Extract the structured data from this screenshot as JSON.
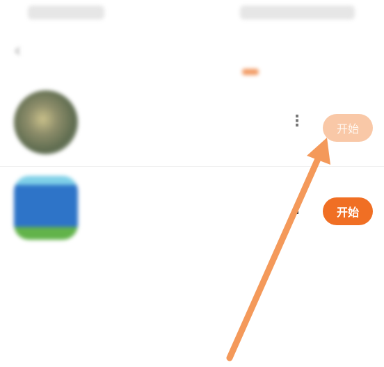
{
  "header": {
    "back_icon": "back-arrow-icon",
    "tabs": [
      {
        "label": "",
        "active": false
      },
      {
        "label": "",
        "active": true
      }
    ]
  },
  "games": [
    {
      "title": "",
      "meta": "",
      "button_label": "开始",
      "button_state": "highlighted"
    },
    {
      "title": "",
      "meta": "",
      "button_label": "开始",
      "button_state": "normal"
    }
  ],
  "colors": {
    "accent": "#f06f24",
    "accent_light": "#f9c8a7",
    "annotation_arrow": "#f4995a"
  }
}
